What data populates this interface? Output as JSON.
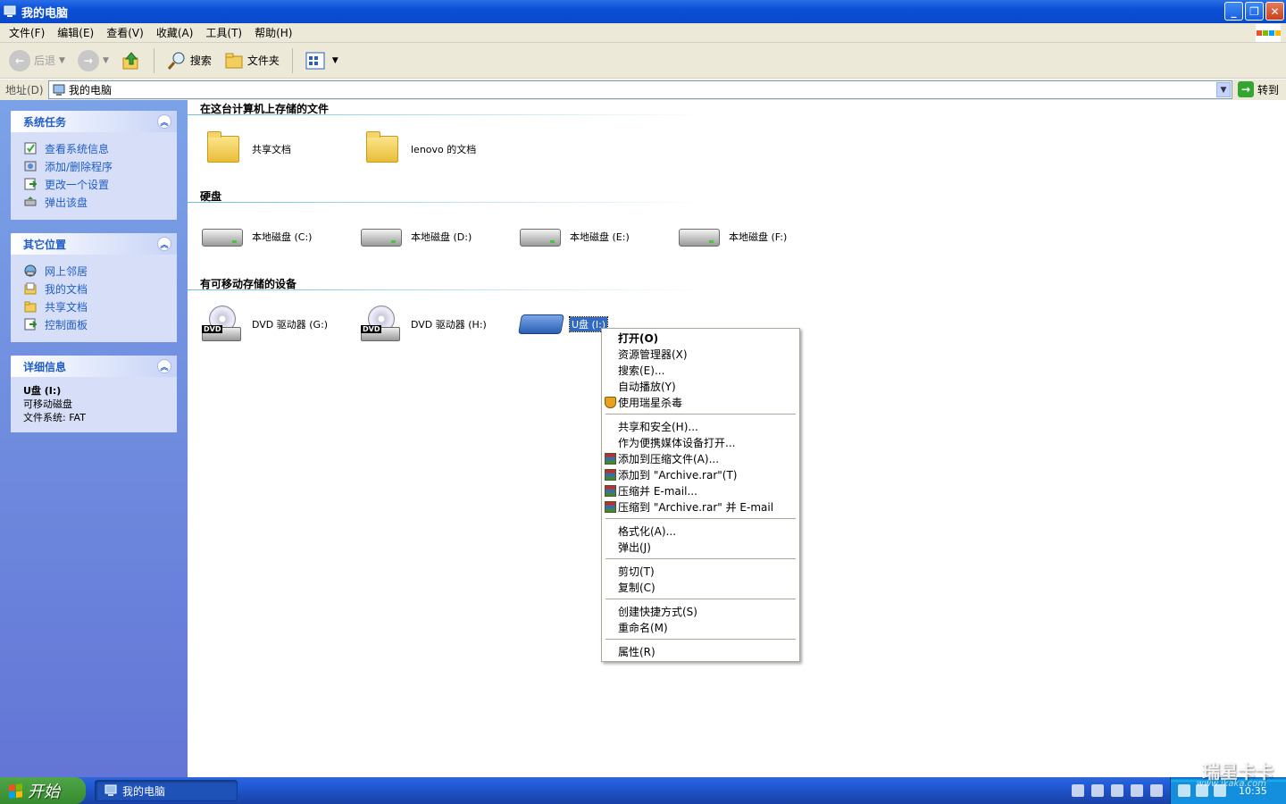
{
  "window": {
    "title": "我的电脑",
    "buttons": {
      "minimize": "_",
      "maximize": "❐",
      "close": "✕"
    }
  },
  "menubar": {
    "items": [
      "文件(F)",
      "编辑(E)",
      "查看(V)",
      "收藏(A)",
      "工具(T)",
      "帮助(H)"
    ]
  },
  "toolbar": {
    "back": "后退",
    "search": "搜索",
    "folders": "文件夹"
  },
  "address": {
    "label": "地址(D)",
    "value": "我的电脑",
    "go": "转到"
  },
  "sidebar": {
    "system_tasks": {
      "title": "系统任务",
      "items": [
        "查看系统信息",
        "添加/删除程序",
        "更改一个设置",
        "弹出该盘"
      ]
    },
    "other_places": {
      "title": "其它位置",
      "items": [
        "网上邻居",
        "我的文档",
        "共享文档",
        "控制面板"
      ]
    },
    "details": {
      "title": "详细信息",
      "name": "U盘 (I:)",
      "type": "可移动磁盘",
      "filesystem": "文件系统: FAT"
    }
  },
  "content": {
    "groups": {
      "files": "在这台计算机上存储的文件",
      "hard_disks": "硬盘",
      "removable": "有可移动存储的设备"
    },
    "files": [
      "共享文档",
      "lenovo 的文档"
    ],
    "disks": [
      "本地磁盘 (C:)",
      "本地磁盘 (D:)",
      "本地磁盘 (E:)",
      "本地磁盘 (F:)"
    ],
    "removable": [
      "DVD 驱动器 (G:)",
      "DVD 驱动器 (H:)",
      "U盘 (I:)"
    ]
  },
  "context_menu": {
    "open": "打开(O)",
    "explorer": "资源管理器(X)",
    "search": "搜索(E)...",
    "autoplay": "自动播放(Y)",
    "rising": "使用瑞星杀毒",
    "sharing": "共享和安全(H)...",
    "portable": "作为便携媒体设备打开...",
    "add_archive": "添加到压缩文件(A)...",
    "add_rar": "添加到 \"Archive.rar\"(T)",
    "compress_email": "压缩并 E-mail...",
    "compress_rar_email": "压缩到 \"Archive.rar\" 并 E-mail",
    "format": "格式化(A)...",
    "eject": "弹出(J)",
    "cut": "剪切(T)",
    "copy": "复制(C)",
    "shortcut": "创建快捷方式(S)",
    "rename": "重命名(M)",
    "properties": "属性(R)"
  },
  "taskbar": {
    "start": "开始",
    "task": "我的电脑",
    "clock": "10:35"
  },
  "watermark": {
    "brand": "瑞星卡卡",
    "url": "www.ikaka.com"
  },
  "colors": {
    "titlebar": "#0a4fd6",
    "sidebar_link": "#215dc6",
    "selection": "#316ac5"
  }
}
